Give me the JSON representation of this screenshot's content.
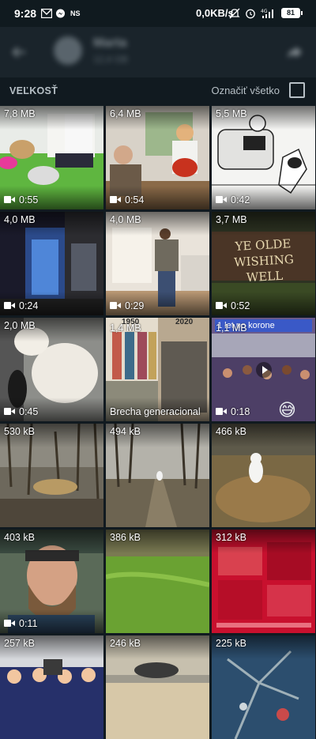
{
  "status_bar": {
    "time": "9:28",
    "icons": [
      "gmail-icon",
      "messenger-icon",
      "ns-icon"
    ],
    "ns_label": "NS",
    "network_speed": "0,0KB/s",
    "right_icons": [
      "mute-icon",
      "alarm-icon",
      "signal-4g-icon"
    ],
    "battery": "81"
  },
  "app_bar": {
    "chat_name": "Marta",
    "chat_subtitle": "12,4 GB"
  },
  "section": {
    "sort_label": "VEĽKOSŤ",
    "select_all_label": "Označiť všetko"
  },
  "colors": {
    "background": "#111a20",
    "app_bar": "#1a242b"
  },
  "media": [
    {
      "size": "7,8 MB",
      "type": "video",
      "duration": "0:55"
    },
    {
      "size": "6,4 MB",
      "type": "video",
      "duration": "0:54"
    },
    {
      "size": "5,5 MB",
      "type": "video",
      "duration": "0:42"
    },
    {
      "size": "4,0 MB",
      "type": "video",
      "duration": "0:24"
    },
    {
      "size": "4,0 MB",
      "type": "video",
      "duration": "0:29"
    },
    {
      "size": "3,7 MB",
      "type": "video",
      "duration": "0:52"
    },
    {
      "size": "2,0 MB",
      "type": "video",
      "duration": "0:45"
    },
    {
      "size": "1,4 MB",
      "type": "image",
      "caption": "Brecha generacional"
    },
    {
      "size": "1,1 MB",
      "type": "video",
      "duration": "0:18"
    },
    {
      "size": "530 kB",
      "type": "image"
    },
    {
      "size": "494 kB",
      "type": "image"
    },
    {
      "size": "466 kB",
      "type": "image"
    },
    {
      "size": "403 kB",
      "type": "video",
      "duration": "0:11"
    },
    {
      "size": "386 kB",
      "type": "image"
    },
    {
      "size": "312 kB",
      "type": "image"
    },
    {
      "size": "257 kB",
      "type": "image"
    },
    {
      "size": "246 kB",
      "type": "image"
    },
    {
      "size": "225 kB",
      "type": "image"
    }
  ],
  "thumb_text": {
    "sign": "YE OLDE WISHING WELL",
    "year_left": "1950",
    "year_right": "2020",
    "banner": "1 let po korone"
  }
}
